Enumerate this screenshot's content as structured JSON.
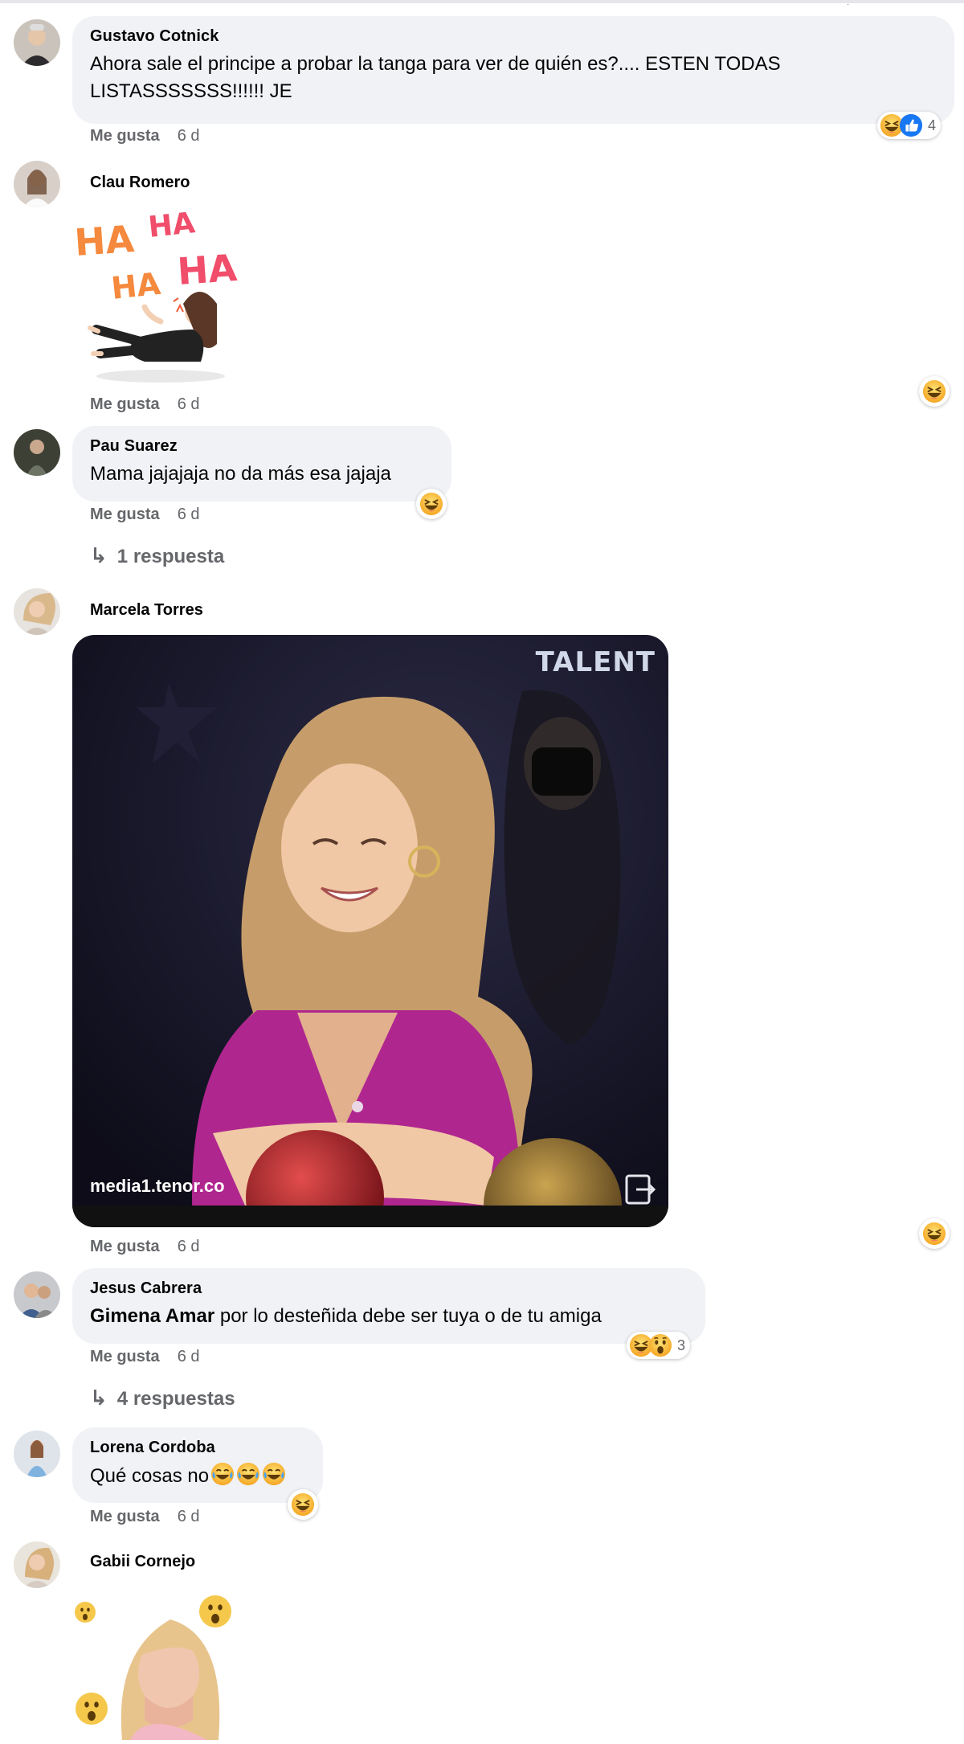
{
  "comments": [
    {
      "author": "Gustavo Cotnick",
      "text": "Ahora sale el principe a probar la tanga para ver de quién es?.... ESTEN TODAS LISTASSSSSSS!!!!!! JE",
      "like_label": "Me gusta",
      "time": "6 d",
      "reactions": [
        "haha",
        "like"
      ],
      "reaction_count": "4"
    },
    {
      "author": "Clau Romero",
      "sticker_text": [
        "HA",
        "HA",
        "HA",
        "HA"
      ],
      "like_label": "Me gusta",
      "time": "6 d",
      "reactions": [
        "haha"
      ]
    },
    {
      "author": "Pau Suarez",
      "text": "Mama jajajaja no da más esa jajaja",
      "like_label": "Me gusta",
      "time": "6 d",
      "reactions": [
        "haha"
      ],
      "replies_label": "1 respuesta"
    },
    {
      "author": "Marcela Torres",
      "gif_source": "media1.tenor.co",
      "gif_watermark": "TALENT",
      "like_label": "Me gusta",
      "time": "6 d",
      "reactions": [
        "haha"
      ]
    },
    {
      "author": "Jesus Cabrera",
      "mention": "Gimena Amar",
      "text": " por lo desteñida debe ser tuya o de tu amiga",
      "like_label": "Me gusta",
      "time": "6 d",
      "reactions": [
        "haha",
        "wow"
      ],
      "reaction_count": "3",
      "replies_label": "4 respuestas"
    },
    {
      "author": "Lorena Cordoba",
      "text": "Qué cosas no",
      "text_emojis": [
        "joy",
        "joy",
        "joy"
      ],
      "like_label": "Me gusta",
      "time": "6 d",
      "reactions": [
        "haha"
      ]
    },
    {
      "author": "Gabii Cornejo",
      "sticker": "surprised-woman-sticker"
    }
  ],
  "colors": {
    "bubble": "#f0f2f5",
    "meta_text": "#65676b",
    "haha_yellow": "#f7b125",
    "like_blue": "#1877f2",
    "gif_dress": "#b0268f"
  }
}
